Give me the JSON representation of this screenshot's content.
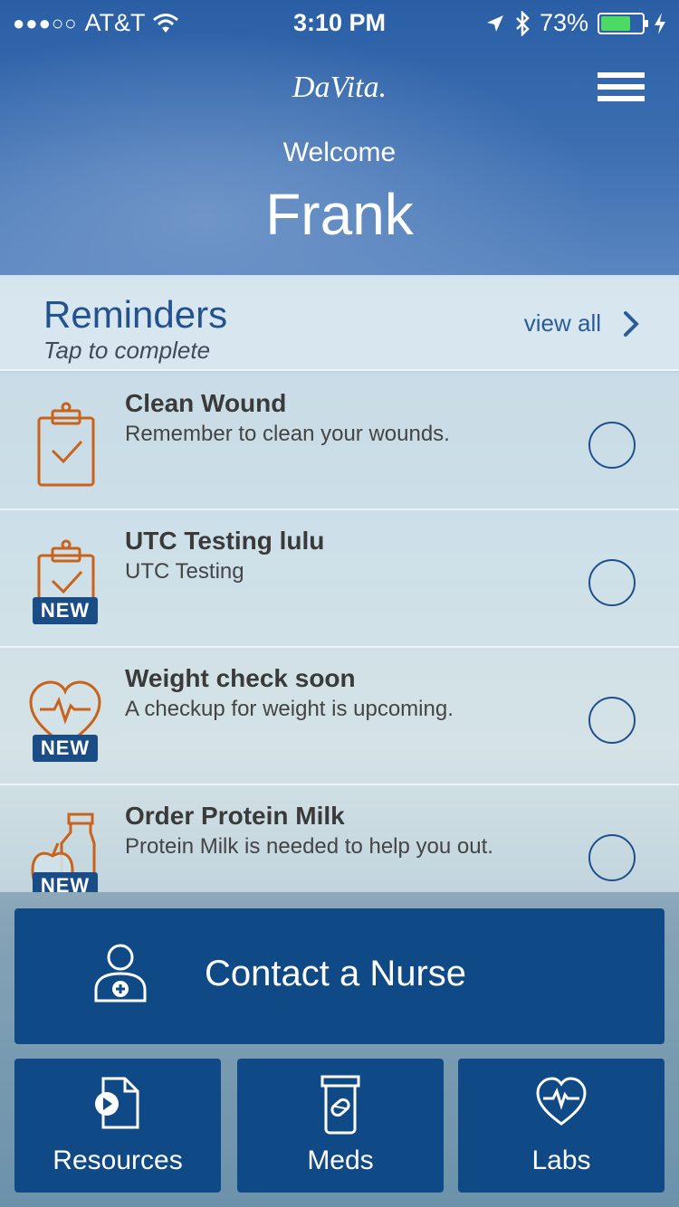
{
  "status_bar": {
    "signal_dots": "●●●○○",
    "carrier": "AT&T",
    "time": "3:10 PM",
    "battery_percent": "73%",
    "battery_level": 0.73,
    "battery_color": "#4cd964",
    "icons": [
      "wifi-icon",
      "location-arrow-icon",
      "bluetooth-icon",
      "battery-icon",
      "charging-bolt-icon"
    ]
  },
  "header": {
    "logo_text": "DaVita.",
    "welcome": "Welcome",
    "user_name": "Frank",
    "menu_icon": "hamburger-menu-icon"
  },
  "reminders": {
    "title": "Reminders",
    "subtitle": "Tap to complete",
    "view_all": "view all",
    "items": [
      {
        "title": "Clean Wound",
        "description": "Remember to clean your wounds.",
        "icon": "clipboard-check-icon",
        "badge": ""
      },
      {
        "title": "UTC Testing lulu",
        "description": "UTC Testing",
        "icon": "clipboard-check-icon",
        "badge": "NEW"
      },
      {
        "title": "Weight check soon",
        "description": "A checkup for weight is upcoming.",
        "icon": "heart-pulse-icon",
        "badge": "NEW"
      },
      {
        "title": "Order Protein Milk",
        "description": "Protein Milk is needed to help you out.",
        "icon": "milk-apple-icon",
        "badge": "NEW"
      }
    ]
  },
  "actions": {
    "contact": {
      "label": "Contact a Nurse",
      "icon": "nurse-icon"
    },
    "tiles": [
      {
        "label": "Resources",
        "icon": "document-play-icon"
      },
      {
        "label": "Meds",
        "icon": "pill-bottle-icon"
      },
      {
        "label": "Labs",
        "icon": "heart-pulse-icon"
      }
    ]
  },
  "colors": {
    "accent_orange": "#c9621b",
    "brand_blue": "#0f4a86",
    "title_blue": "#23538f"
  }
}
